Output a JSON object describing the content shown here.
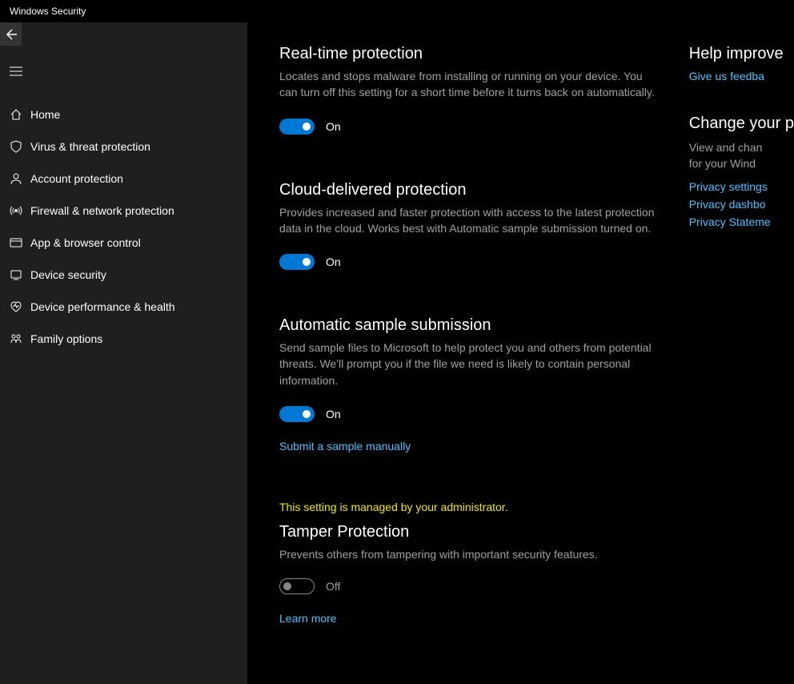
{
  "app_title": "Windows Security",
  "sidebar": {
    "items": [
      {
        "label": "Home",
        "icon": "home"
      },
      {
        "label": "Virus & threat protection",
        "icon": "shield"
      },
      {
        "label": "Account protection",
        "icon": "person"
      },
      {
        "label": "Firewall & network protection",
        "icon": "antenna"
      },
      {
        "label": "App & browser control",
        "icon": "browser"
      },
      {
        "label": "Device security",
        "icon": "device"
      },
      {
        "label": "Device performance & health",
        "icon": "heart"
      },
      {
        "label": "Family options",
        "icon": "family"
      }
    ]
  },
  "sections": {
    "realtime": {
      "title": "Real-time protection",
      "description": "Locates and stops malware from installing or running on your device. You can turn off this setting for a short time before it turns back on automatically.",
      "toggle_state": "On"
    },
    "cloud": {
      "title": "Cloud-delivered protection",
      "description": "Provides increased and faster protection with access to the latest protection data in the cloud. Works best with Automatic sample submission turned on.",
      "toggle_state": "On"
    },
    "sample": {
      "title": "Automatic sample submission",
      "description": "Send sample files to Microsoft to help protect you and others from potential threats. We'll prompt you if the file we need is likely to contain personal information.",
      "toggle_state": "On",
      "link": "Submit a sample manually"
    },
    "tamper": {
      "admin_notice": "This setting is managed by your administrator.",
      "title": "Tamper Protection",
      "description": "Prevents others from tampering with important security features.",
      "toggle_state": "Off",
      "link": "Learn more"
    }
  },
  "right_panel": {
    "help": {
      "title": "Help improve",
      "link": "Give us feedba"
    },
    "privacy": {
      "title": "Change your p",
      "description_line1": "View and chan",
      "description_line2": "for your Wind",
      "links": [
        "Privacy settings",
        "Privacy dashbo",
        "Privacy Stateme"
      ]
    }
  }
}
